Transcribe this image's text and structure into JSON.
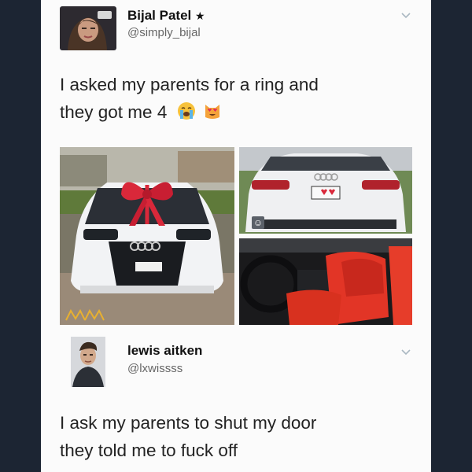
{
  "colors": {
    "page_background": "#1c2533",
    "card_background": "#fbfbfb",
    "name_text": "#111111",
    "handle_text": "#666666",
    "tweet_text": "#222222",
    "chevron": "#aab8c2",
    "car_white": "#f2f3f5",
    "bow_red": "#d9283a",
    "seat_red": "#e23526"
  },
  "tweets": [
    {
      "author_name": "Bijal Patel",
      "badge_icon": "star-icon",
      "badge": "★",
      "handle": "@simply_bijal",
      "avatar_icon": "profile-photo-woman",
      "menu_icon": "chevron-down-icon",
      "text_line1": "I asked my parents for a ring and",
      "text_line2": "they got me 4",
      "emojis": [
        "crying-face-emoji",
        "heart-eyes-cat-emoji"
      ],
      "media": [
        {
          "icon": "photo-white-audi-front-with-red-bow"
        },
        {
          "icon": "photo-white-audi-rear"
        },
        {
          "icon": "photo-red-leather-interior"
        }
      ],
      "media_badge_icon": "smiley-sticker-icon"
    },
    {
      "author_name": "lewis aitken",
      "handle": "@lxwissss",
      "avatar_icon": "profile-photo-man",
      "menu_icon": "chevron-down-icon",
      "text_line1": "I ask my parents to shut my door",
      "text_line2": "they told me to fuck off"
    }
  ]
}
